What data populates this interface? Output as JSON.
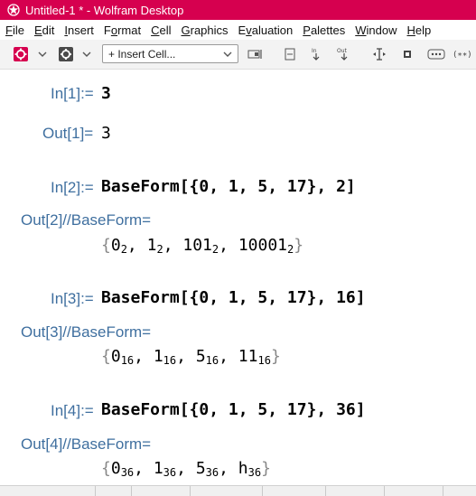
{
  "window": {
    "title": "Untitled-1 * - Wolfram Desktop"
  },
  "menu": [
    {
      "label": "File",
      "key": "F"
    },
    {
      "label": "Edit",
      "key": "E"
    },
    {
      "label": "Insert",
      "key": "I"
    },
    {
      "label": "Format",
      "key": "o"
    },
    {
      "label": "Cell",
      "key": "C"
    },
    {
      "label": "Graphics",
      "key": "G"
    },
    {
      "label": "Evaluation",
      "key": "v"
    },
    {
      "label": "Palettes",
      "key": "P"
    },
    {
      "label": "Window",
      "key": "W"
    },
    {
      "label": "Help",
      "key": "H"
    }
  ],
  "toolbar": {
    "insert_cell_label": "+ Insert Cell...",
    "icons": [
      "evaluation-stop-icon",
      "chevron-down-icon",
      "gear-box-icon",
      "chevron-down-icon",
      "input-box-icon",
      "cell-bracket-icon",
      "input-arrow-icon",
      "output-arrow-icon",
      "text-cursor-icon",
      "delimiter-icon",
      "more-icon",
      "code-icon"
    ]
  },
  "cells": {
    "in1": {
      "label": "In[1]:=",
      "code": "3"
    },
    "out1": {
      "label": "Out[1]=",
      "value": "3"
    },
    "in2": {
      "label": "In[2]:=",
      "fn": "BaseForm",
      "args": "[{0, 1, 5, 17}, 2]"
    },
    "out2": {
      "label": "Out[2]//BaseForm=",
      "items": [
        {
          "v": "0",
          "b": "2"
        },
        {
          "v": "1",
          "b": "2"
        },
        {
          "v": "101",
          "b": "2"
        },
        {
          "v": "10001",
          "b": "2"
        }
      ]
    },
    "in3": {
      "label": "In[3]:=",
      "fn": "BaseForm",
      "args": "[{0, 1, 5, 17}, 16]"
    },
    "out3": {
      "label": "Out[3]//BaseForm=",
      "items": [
        {
          "v": "0",
          "b": "16"
        },
        {
          "v": "1",
          "b": "16"
        },
        {
          "v": "5",
          "b": "16"
        },
        {
          "v": "11",
          "b": "16"
        }
      ]
    },
    "in4": {
      "label": "In[4]:=",
      "fn": "BaseForm",
      "args": "[{0, 1, 5, 17}, 36]"
    },
    "out4": {
      "label": "Out[4]//BaseForm=",
      "items": [
        {
          "v": "0",
          "b": "36"
        },
        {
          "v": "1",
          "b": "36"
        },
        {
          "v": "5",
          "b": "36"
        },
        {
          "v": "h",
          "b": "36"
        }
      ]
    }
  },
  "colors": {
    "titlebar": "#d6004f",
    "label": "#3f6f9f"
  }
}
